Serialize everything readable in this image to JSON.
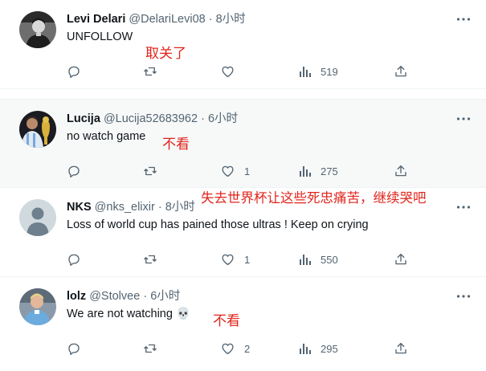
{
  "tweets": [
    {
      "name": "Levi Delari",
      "handle": "@DelariLevi08",
      "separator": "·",
      "time": "8小时",
      "text": "UNFOLLOW",
      "emoji": "",
      "annotation": "取关了",
      "replies": "",
      "retweets": "",
      "likes": "",
      "views": "519",
      "avatar_icon": "profile-photo-bw-icon"
    },
    {
      "name": "Lucija",
      "handle": "@Lucija52683962",
      "separator": "·",
      "time": "6小时",
      "text": "no watch game",
      "emoji": "",
      "annotation": "不看",
      "replies": "",
      "retweets": "",
      "likes": "1",
      "views": "275",
      "avatar_icon": "profile-photo-trophy-icon"
    },
    {
      "name": "NKS",
      "handle": "@nks_elixir",
      "separator": "·",
      "time": "8小时",
      "text": "Loss of world cup has pained those ultras ! Keep on crying",
      "emoji": "",
      "annotation": "失去世界杯让这些死忠痛苦，继续哭吧",
      "replies": "",
      "retweets": "",
      "likes": "1",
      "views": "550",
      "avatar_icon": "default-avatar-icon"
    },
    {
      "name": "lolz",
      "handle": "@Stolvee",
      "separator": "·",
      "time": "6小时",
      "text": "We are not watching",
      "emoji": "💀",
      "annotation": "不看",
      "replies": "",
      "retweets": "",
      "likes": "2",
      "views": "295",
      "avatar_icon": "profile-photo-footballer-icon"
    }
  ],
  "colors": {
    "annotation": "#e0241c",
    "secondary_text": "#536471",
    "highlight_bg": "#f7f9f9",
    "divider": "#eff3f4"
  }
}
